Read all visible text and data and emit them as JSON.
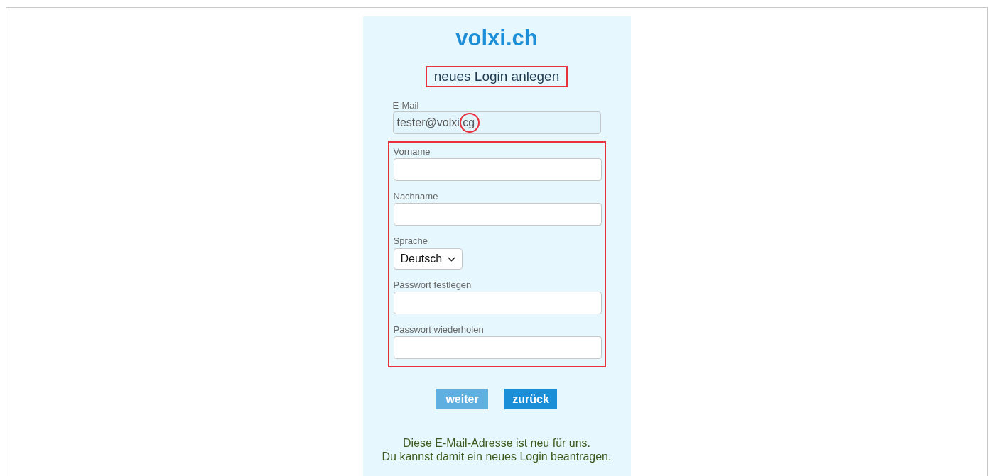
{
  "site_title": "volxi.ch",
  "heading": {
    "text": "neues Login anlegen",
    "highlighted": true
  },
  "email": {
    "label": "E-Mail",
    "value": "tester@volxi.cg",
    "circled": true
  },
  "fields_group_highlighted": true,
  "fields": [
    {
      "kind": "text",
      "label": "Vorname"
    },
    {
      "kind": "text",
      "label": "Nachname"
    },
    {
      "kind": "select",
      "label": "Sprache",
      "value": "Deutsch"
    },
    {
      "kind": "text",
      "label": "Passwort festlegen"
    },
    {
      "kind": "text",
      "label": "Passwort wiederholen"
    }
  ],
  "buttons": [
    {
      "label": "weiter",
      "disabled": true
    },
    {
      "label": "zurück",
      "disabled": false
    }
  ],
  "message": [
    "Diese E-Mail-Adresse ist neu für uns.",
    "Du kannst damit ein neues Login beantragen."
  ]
}
